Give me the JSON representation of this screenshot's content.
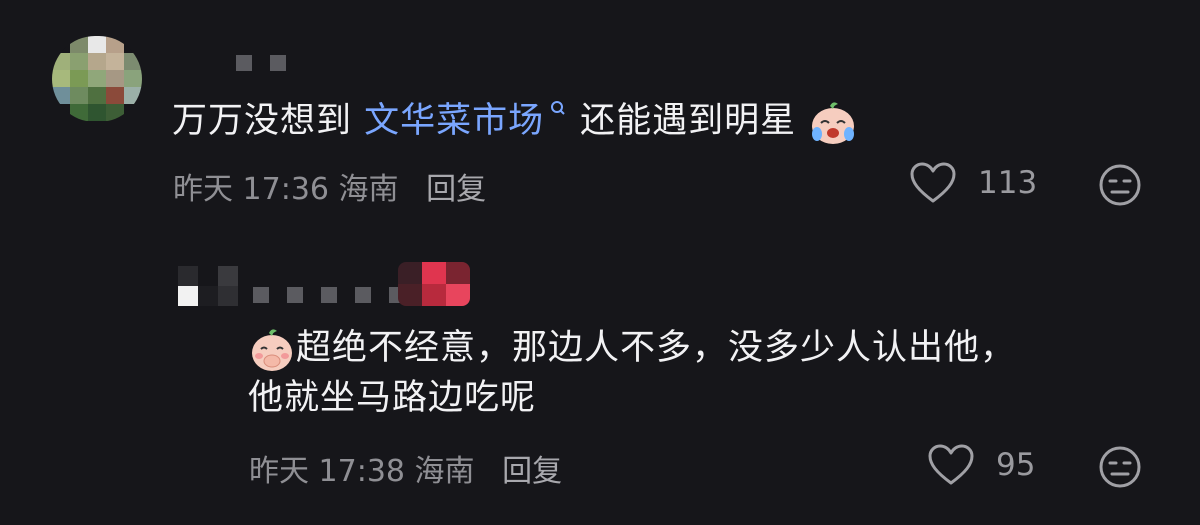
{
  "comments": [
    {
      "text_before": "万万没想到 ",
      "link_text": "文华菜市场",
      "text_after": "还能遇到明星",
      "emoji": "crying-laughing-emoji",
      "time": "昨天 17:36",
      "location": "海南",
      "reply_label": "回复",
      "likes": "113"
    }
  ],
  "reply": {
    "line1": "超绝不经意，那边人不多，没多少人认出他，",
    "line2": "他就坐马路边吃呢",
    "emoji": "shy-laughing-emoji",
    "time": "昨天 17:38",
    "location": "海南",
    "reply_label": "回复",
    "likes": "95"
  },
  "colors": {
    "background": "#16161a",
    "link": "#7aa6ff",
    "meta": "#8f8f94"
  }
}
